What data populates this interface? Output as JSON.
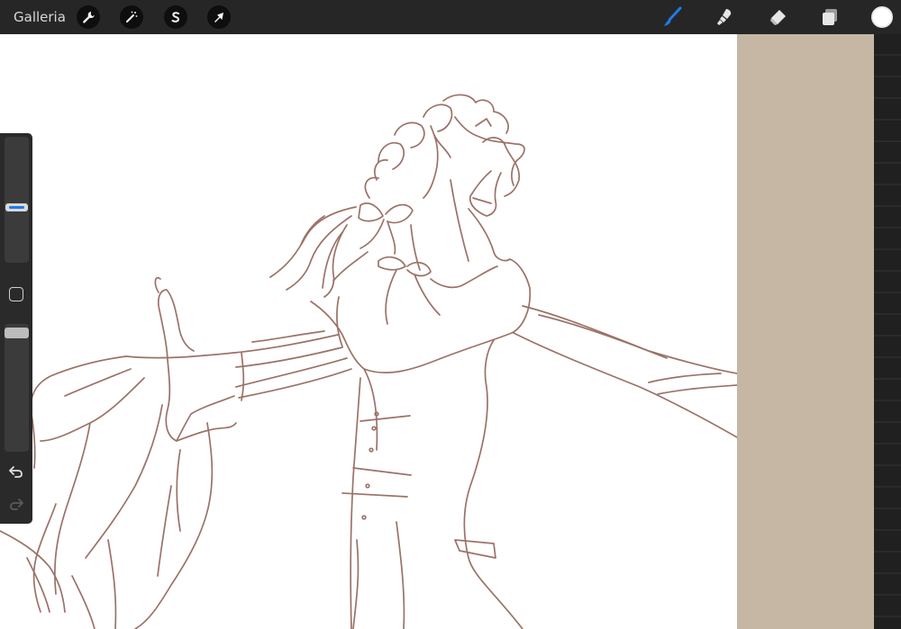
{
  "app": {
    "gallery_label": "Galleria"
  },
  "toolbar": {
    "left_tools": [
      {
        "name": "actions",
        "icon": "wrench-icon"
      },
      {
        "name": "adjustments",
        "icon": "magic-wand-icon"
      },
      {
        "name": "selection",
        "icon": "selection-s-icon"
      },
      {
        "name": "transform",
        "icon": "arrow-cursor-icon"
      }
    ],
    "right_tools": [
      {
        "name": "brush",
        "icon": "brush-icon",
        "active": true
      },
      {
        "name": "smudge",
        "icon": "smudge-icon"
      },
      {
        "name": "eraser",
        "icon": "eraser-icon"
      },
      {
        "name": "layers",
        "icon": "layers-icon"
      }
    ],
    "current_color": "#ffffff",
    "active_color": "#1f7ae8"
  },
  "sidebar": {
    "brush_size_level": 0.58,
    "brush_opacity_level": 1.0,
    "modify_icon": "square-icon",
    "undo_icon": "undo-icon",
    "redo_icon": "redo-icon"
  },
  "canvas": {
    "background": "#ffffff",
    "sketch_color": "#8a5a4e",
    "side_panel_color": "#c5b7a3"
  }
}
